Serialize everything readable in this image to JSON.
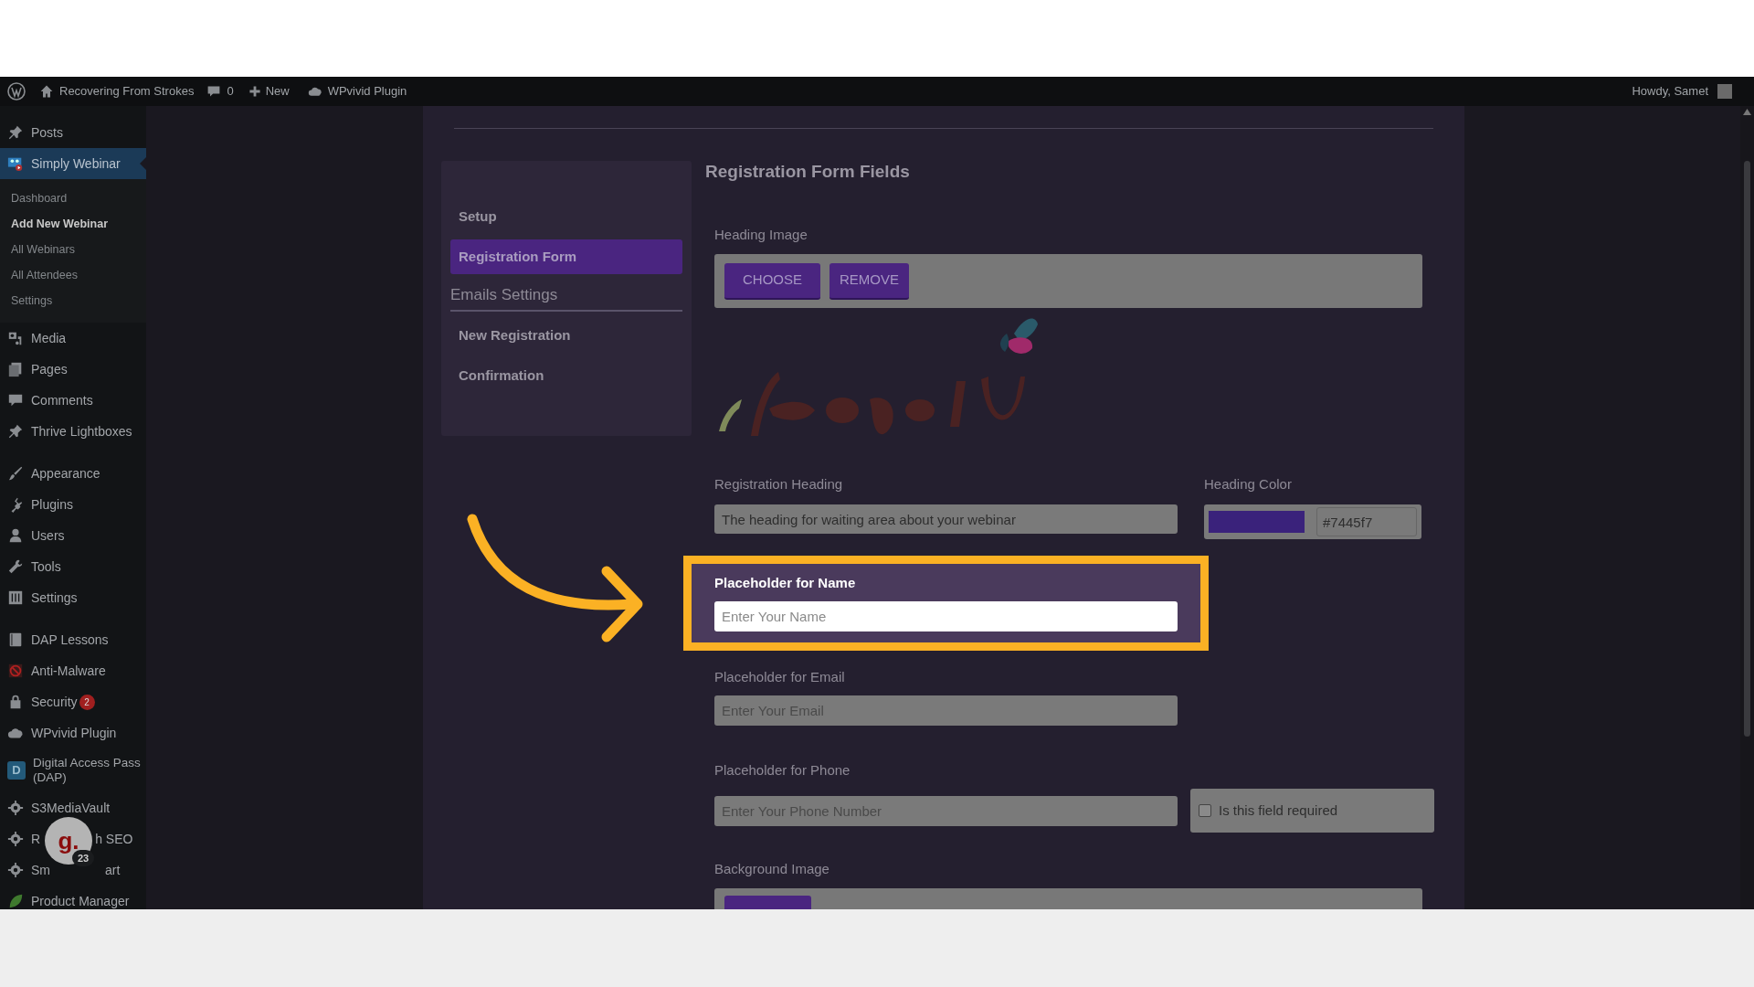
{
  "admin_bar": {
    "site": "Recovering From Strokes",
    "comments": "0",
    "new": "New",
    "plugin": "WPvivid Plugin",
    "greeting": "Howdy, Samet"
  },
  "sidebar": {
    "items": [
      {
        "kind": "item",
        "label": "Posts",
        "selected": false
      },
      {
        "kind": "item",
        "label": "Simply Webinar",
        "selected": true,
        "children": [
          {
            "label": "Dashboard",
            "selected": false
          },
          {
            "label": "Add New Webinar",
            "selected": true
          },
          {
            "label": "All Webinars",
            "selected": false
          },
          {
            "label": "All Attendees",
            "selected": false
          },
          {
            "label": "Settings",
            "selected": false
          }
        ]
      },
      {
        "kind": "item",
        "label": "Media",
        "selected": false
      },
      {
        "kind": "item",
        "label": "Pages",
        "selected": false
      },
      {
        "kind": "item",
        "label": "Comments",
        "selected": false
      },
      {
        "kind": "item",
        "label": "Thrive Lightboxes",
        "selected": false
      },
      {
        "kind": "separator"
      },
      {
        "kind": "item",
        "label": "Appearance",
        "selected": false
      },
      {
        "kind": "item",
        "label": "Plugins",
        "selected": false
      },
      {
        "kind": "item",
        "label": "Users",
        "selected": false
      },
      {
        "kind": "item",
        "label": "Tools",
        "selected": false
      },
      {
        "kind": "item",
        "label": "Settings",
        "selected": false
      },
      {
        "kind": "separator"
      },
      {
        "kind": "item",
        "label": "DAP Lessons",
        "selected": false
      },
      {
        "kind": "item",
        "label": "Anti-Malware",
        "selected": false
      },
      {
        "kind": "item",
        "label": "Security",
        "selected": false,
        "badge": "2"
      },
      {
        "kind": "item",
        "label": "WPvivid Plugin",
        "selected": false
      },
      {
        "kind": "item",
        "label": "Digital Access Pass (DAP)",
        "selected": false,
        "icon_letter": "D"
      },
      {
        "kind": "item",
        "label": "S3MediaVault",
        "selected": false
      },
      {
        "kind": "item",
        "label_parts": [
          "R",
          "h SEO"
        ],
        "selected": false
      },
      {
        "kind": "item",
        "label_parts": [
          "Sm",
          "art"
        ],
        "selected": false
      },
      {
        "kind": "item",
        "label": "Product Manager",
        "selected": false
      }
    ]
  },
  "overlay_badge": {
    "letter": "g.",
    "count": "23"
  },
  "settings_nav": {
    "items": [
      {
        "kind": "link",
        "label": "Setup",
        "selected": false
      },
      {
        "kind": "link",
        "label": "Registration Form",
        "selected": true
      },
      {
        "kind": "heading",
        "label": "Emails Settings"
      },
      {
        "kind": "link",
        "label": "New Registration",
        "selected": false
      },
      {
        "kind": "link",
        "label": "Confirmation",
        "selected": false
      }
    ]
  },
  "form": {
    "title": "Registration Form Fields",
    "heading_image": {
      "label": "Heading Image",
      "buttons": [
        "CHOOSE",
        "REMOVE"
      ],
      "preview": {
        "kind": "picture"
      }
    },
    "registration_heading": {
      "label": "Registration Heading",
      "value": "The heading for waiting area about your webinar"
    },
    "heading_color": {
      "label": "Heading Color",
      "value": "#7445f7"
    },
    "fields": [
      {
        "label": "Placeholder for Name",
        "placeholder": "Enter Your Name",
        "highlighted": true
      },
      {
        "label": "Placeholder for Email",
        "placeholder": "Enter Your Email",
        "highlighted": false
      },
      {
        "label": "Placeholder for Phone",
        "placeholder": "Enter Your Phone Number",
        "highlighted": false,
        "required_option": {
          "label": "Is this field required",
          "checked": false
        }
      }
    ],
    "background_image": {
      "label": "Background Image"
    }
  }
}
